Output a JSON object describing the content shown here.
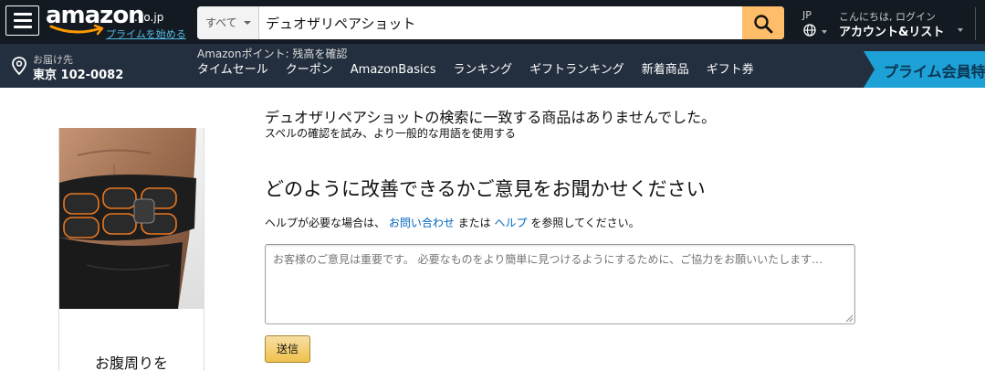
{
  "header": {
    "logo_text": "amazon",
    "logo_tld": ".co.jp",
    "prime_start_link": "プライムを始める",
    "search": {
      "department": "すべて",
      "query": "デュオザリペアショット"
    },
    "language": "JP",
    "account_hello": "こんにちは, ログイン",
    "account_main": "アカウント&リスト"
  },
  "subnav": {
    "deliver_label": "お届け先",
    "deliver_location": "東京 102-0082",
    "points": "Amazonポイント: 残高を確認",
    "links": [
      "タイムセール",
      "クーポン",
      "AmazonBasics",
      "ランキング",
      "ギフトランキング",
      "新着商品",
      "ギフト券"
    ],
    "prime_banner": "プライム会員特"
  },
  "main": {
    "no_results": "デュオザリペアショットの検索に一致する商品はありませんでした。",
    "no_results_hint": "スペルの確認を試み、より一般的な用語を使用する",
    "feedback_title": "どのように改善できるかご意見をお聞かせください",
    "help": {
      "prefix": "ヘルプが必要な場合は、",
      "contact_link": "お問い合わせ",
      "middle": " または ",
      "help_link": "ヘルプ",
      "suffix": " を参照してください。"
    },
    "feedback_placeholder": "お客様のご意見は重要です。 必要なものをより簡単に見つけるようにするために、ご協力をお願いいたします…",
    "submit_label": "送信"
  },
  "sidebar_ad": {
    "caption": "お腹周りを"
  },
  "colors": {
    "nav_top": "#131a22",
    "nav_bottom": "#232f3e",
    "search_button": "#febd69",
    "link": "#0066c0",
    "prime_blue": "#1da1d6"
  }
}
